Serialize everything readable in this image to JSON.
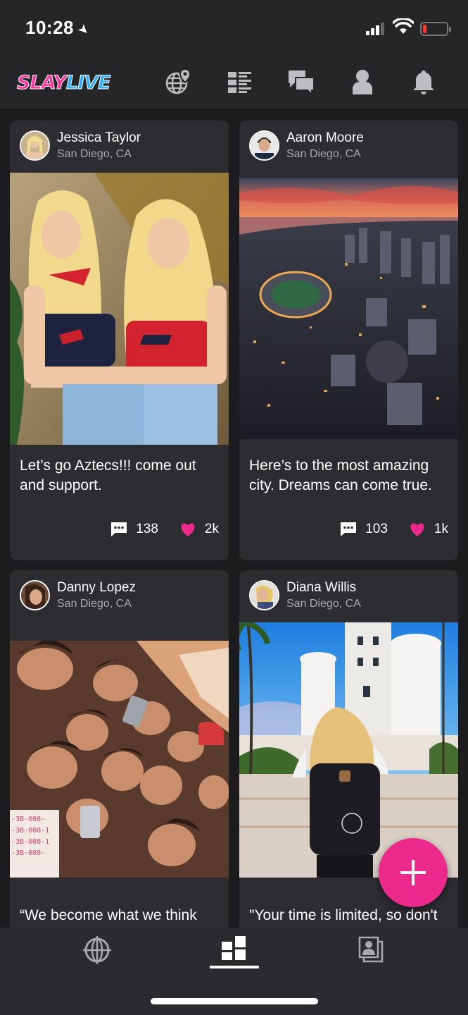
{
  "status_bar": {
    "time": "10:28",
    "battery_level_percent": 8
  },
  "nav": {
    "logo_part1": "SLAY",
    "logo_part2": "LIVE",
    "icons": [
      "globe-pin-icon",
      "list-icon",
      "chat-icon",
      "profile-icon",
      "bell-icon"
    ]
  },
  "posts": [
    {
      "author": "Jessica Taylor",
      "location": "San Diego, CA",
      "caption": "Let’s go Aztecs!!! come out and support.",
      "comments": "138",
      "likes": "2k"
    },
    {
      "author": "Aaron Moore",
      "location": "San Diego, CA",
      "caption": "Here’s to the most amazing city.  Dreams can come true.",
      "comments": "103",
      "likes": "1k"
    },
    {
      "author": "Danny Lopez",
      "location": "San Diego, CA",
      "caption": "“We become what we think",
      "comments": "",
      "likes": ""
    },
    {
      "author": "Diana Willis",
      "location": "San Diego, CA",
      "caption": "\"Your time is limited, so don't",
      "comments": "",
      "likes": ""
    }
  ],
  "tabs": [
    {
      "icon": "globe-target-icon",
      "active": false
    },
    {
      "icon": "grid-feed-icon",
      "active": true
    },
    {
      "icon": "contacts-icon",
      "active": false
    }
  ],
  "colors": {
    "accent": "#ec2a8b",
    "background": "#1c1c1f",
    "card": "#2d2c31",
    "bar": "#262629"
  }
}
